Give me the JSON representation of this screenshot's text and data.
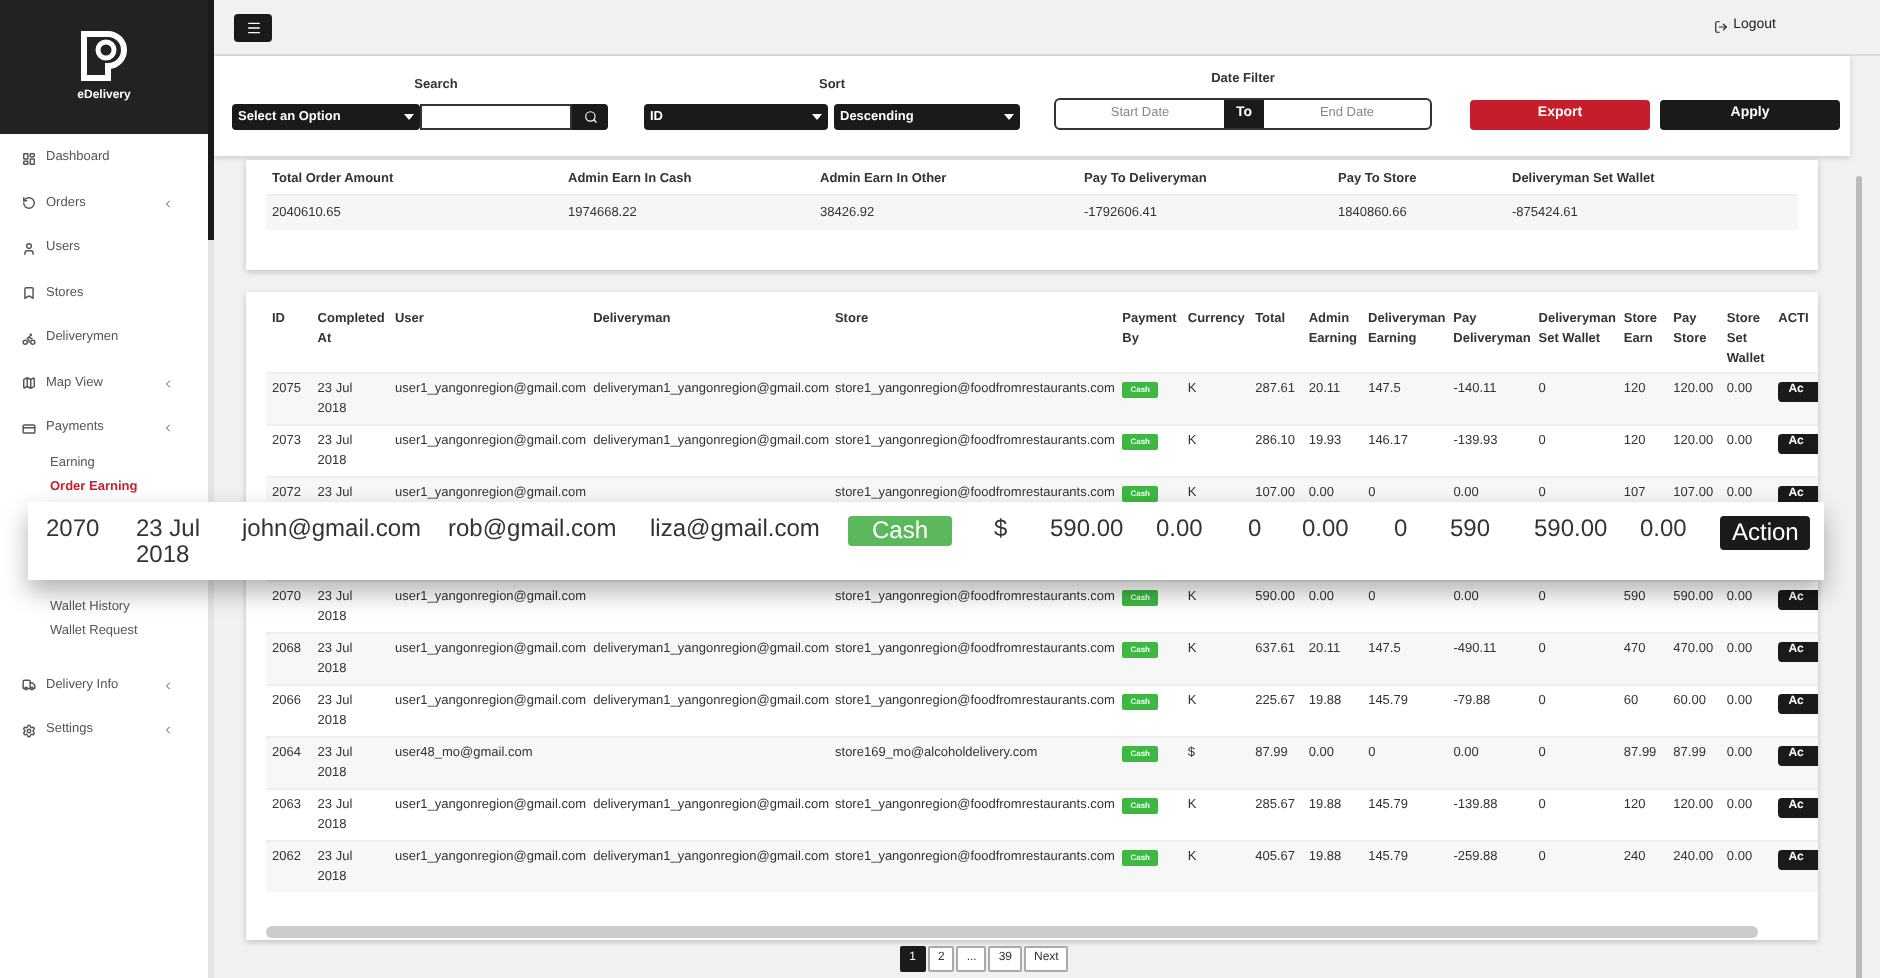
{
  "brand": {
    "name": "eDelivery"
  },
  "topbar": {
    "logout": "Logout"
  },
  "sidebar": {
    "items": [
      {
        "label": "Dashboard",
        "expandable": false
      },
      {
        "label": "Orders",
        "expandable": true
      },
      {
        "label": "Users",
        "expandable": false
      },
      {
        "label": "Stores",
        "expandable": false
      },
      {
        "label": "Deliverymen",
        "expandable": false
      },
      {
        "label": "Map View",
        "expandable": true
      },
      {
        "label": "Payments",
        "expandable": true,
        "children": [
          {
            "label": "Earning",
            "selected": false
          },
          {
            "label": "Order Earning",
            "selected": true
          },
          {
            "label": "Wallet History",
            "selected": false
          },
          {
            "label": "Wallet Request",
            "selected": false
          }
        ]
      },
      {
        "label": "Delivery Info",
        "expandable": true
      },
      {
        "label": "Settings",
        "expandable": true
      }
    ]
  },
  "filters": {
    "search_label": "Search",
    "search_select": "Select an Option",
    "sort_label": "Sort",
    "sort_field": "ID",
    "sort_order": "Descending",
    "date_label": "Date Filter",
    "start_placeholder": "Start Date",
    "to": "To",
    "end_placeholder": "End Date",
    "export": "Export",
    "apply": "Apply"
  },
  "summary": {
    "columns": [
      "Total Order Amount",
      "Admin Earn In Cash",
      "Admin Earn In Other",
      "Pay To Deliveryman",
      "Pay To Store",
      "Deliveryman Set Wallet"
    ],
    "values": [
      "2040610.65",
      "1974668.22",
      "38426.92",
      "-1792606.41",
      "1840860.66",
      "-875424.61"
    ]
  },
  "table": {
    "columns": [
      "ID",
      "Completed At",
      "User",
      "Deliveryman",
      "Store",
      "Payment By",
      "Currency",
      "Total",
      "Admin Earning",
      "Deliveryman Earning",
      "Pay Deliveryman",
      "Deliveryman Set Wallet",
      "Store Earn",
      "Pay Store",
      "Store Set Wallet",
      "ACTI"
    ],
    "rows": [
      {
        "cells": [
          "2075",
          "23 Jul 2018",
          "user1_yangonregion@gmail.com",
          "deliveryman1_yangonregion@gmail.com",
          "store1_yangonregion@foodfromrestaurants.com",
          "Cash",
          "K",
          "287.61",
          "20.11",
          "147.5",
          "-140.11",
          "0",
          "120",
          "120.00",
          "0.00",
          "Ac"
        ]
      },
      {
        "cells": [
          "2073",
          "23 Jul 2018",
          "user1_yangonregion@gmail.com",
          "deliveryman1_yangonregion@gmail.com",
          "store1_yangonregion@foodfromrestaurants.com",
          "Cash",
          "K",
          "286.10",
          "19.93",
          "146.17",
          "-139.93",
          "0",
          "120",
          "120.00",
          "0.00",
          "Ac"
        ]
      },
      {
        "cells": [
          "2072",
          "23 Jul",
          "user1_yangonregion@gmail.com",
          "",
          "store1_yangonregion@foodfromrestaurants.com",
          "Cash",
          "K",
          "107.00",
          "0.00",
          "0",
          "0.00",
          "0",
          "107",
          "107.00",
          "0.00",
          "Ac"
        ]
      },
      {
        "cells": [
          "2070",
          "23 Jul 2018",
          "user1_yangonregion@gmail.com",
          "",
          "store1_yangonregion@foodfromrestaurants.com",
          "Cash",
          "K",
          "590.00",
          "0.00",
          "0",
          "0.00",
          "0",
          "590",
          "590.00",
          "0.00",
          "Ac"
        ]
      },
      {
        "cells": [
          "2068",
          "23 Jul 2018",
          "user1_yangonregion@gmail.com",
          "deliveryman1_yangonregion@gmail.com",
          "store1_yangonregion@foodfromrestaurants.com",
          "Cash",
          "K",
          "637.61",
          "20.11",
          "147.5",
          "-490.11",
          "0",
          "470",
          "470.00",
          "0.00",
          "Ac"
        ]
      },
      {
        "cells": [
          "2066",
          "23 Jul 2018",
          "user1_yangonregion@gmail.com",
          "deliveryman1_yangonregion@gmail.com",
          "store1_yangonregion@foodfromrestaurants.com",
          "Cash",
          "K",
          "225.67",
          "19.88",
          "145.79",
          "-79.88",
          "0",
          "60",
          "60.00",
          "0.00",
          "Ac"
        ]
      },
      {
        "cells": [
          "2064",
          "23 Jul 2018",
          "user48_mo@gmail.com",
          "",
          "store169_mo@alcoholdelivery.com",
          "Cash",
          "$",
          "87.99",
          "0.00",
          "0",
          "0.00",
          "0",
          "87.99",
          "87.99",
          "0.00",
          "Ac"
        ]
      },
      {
        "cells": [
          "2063",
          "23 Jul 2018",
          "user1_yangonregion@gmail.com",
          "deliveryman1_yangonregion@gmail.com",
          "store1_yangonregion@foodfromrestaurants.com",
          "Cash",
          "K",
          "285.67",
          "19.88",
          "145.79",
          "-139.88",
          "0",
          "120",
          "120.00",
          "0.00",
          "Ac"
        ]
      },
      {
        "cells": [
          "2062",
          "23 Jul 2018",
          "user1_yangonregion@gmail.com",
          "deliveryman1_yangonregion@gmail.com",
          "store1_yangonregion@foodfromrestaurants.com",
          "Cash",
          "K",
          "405.67",
          "19.88",
          "145.79",
          "-259.88",
          "0",
          "240",
          "240.00",
          "0.00",
          "Ac"
        ]
      }
    ]
  },
  "highlight_row": {
    "cells": [
      "2070",
      "23 Jul 2018",
      "john@gmail.com",
      "rob@gmail.com",
      "liza@gmail.com",
      "Cash",
      "$",
      "590.00",
      "0.00",
      "0",
      "0.00",
      "0",
      "590",
      "590.00",
      "0.00",
      "Action"
    ]
  },
  "pagination": [
    {
      "label": "1",
      "selected": true
    },
    {
      "label": "2",
      "selected": false
    },
    {
      "label": "...",
      "selected": false
    },
    {
      "label": "39",
      "selected": false
    },
    {
      "label": "Next",
      "selected": false
    }
  ]
}
